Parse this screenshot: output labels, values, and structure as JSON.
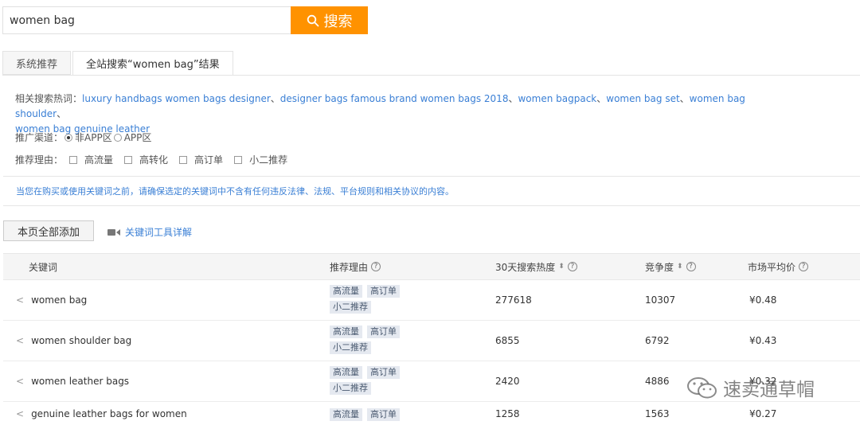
{
  "search": {
    "value": "women bag",
    "button_label": "搜索"
  },
  "tabs": [
    {
      "label": "系统推荐",
      "active": false
    },
    {
      "label": "全站搜索“women bag”结果",
      "active": true
    }
  ],
  "related": {
    "label": "相关搜索热词：",
    "items": [
      "luxury handbags women bags designer",
      "designer bags famous brand women bags 2018",
      "women bagpack",
      "women bag set",
      "women bag shoulder",
      "women bag genuine leather"
    ],
    "separator": "、"
  },
  "channel": {
    "label": "推广渠道：",
    "options": [
      "非APP区",
      "APP区"
    ],
    "selected": "非APP区"
  },
  "reason_filter": {
    "label": "推荐理由：",
    "options": [
      "高流量",
      "高转化",
      "高订单",
      "小二推荐"
    ]
  },
  "notice": "当您在购买或使用关键词之前，请确保选定的关键词中不含有任何违反法律、法规、平台规则和相关协议的内容。",
  "actions": {
    "add_all_label": "本页全部添加",
    "tool_link_label": "关键词工具详解"
  },
  "table": {
    "headers": {
      "keyword": "关键词",
      "reason": "推荐理由",
      "heat": "30天搜索热度",
      "competition": "竞争度",
      "price": "市场平均价"
    },
    "rows": [
      {
        "keyword": "women bag",
        "tags": [
          "高流量",
          "高订单",
          "小二推荐"
        ],
        "heat": "277618",
        "competition": "10307",
        "price": "¥0.48"
      },
      {
        "keyword": "women shoulder bag",
        "tags": [
          "高流量",
          "高订单",
          "小二推荐"
        ],
        "heat": "6855",
        "competition": "6792",
        "price": "¥0.43"
      },
      {
        "keyword": "women leather bags",
        "tags": [
          "高流量",
          "高订单",
          "小二推荐"
        ],
        "heat": "2420",
        "competition": "4886",
        "price": "¥0.32"
      },
      {
        "keyword": "genuine leather bags for women",
        "tags": [
          "高流量",
          "高订单"
        ],
        "heat": "1258",
        "competition": "1563",
        "price": "¥0.27"
      }
    ]
  },
  "watermark": "速卖通草帽",
  "colors": {
    "accent": "#ff9200",
    "link": "#3a7fd5"
  }
}
